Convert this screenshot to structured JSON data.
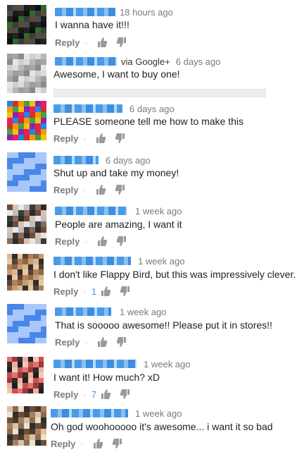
{
  "labels": {
    "reply": "Reply"
  },
  "comments": [
    {
      "via": "",
      "time": "18 hours ago",
      "text": "I wanna have it!!!",
      "likes": "",
      "avatar_colors": [
        "#3b3b3b",
        "#1a1a1a",
        "#2d6b2a",
        "#4c4c4c",
        "#0f0f0f",
        "#5a4a3a",
        "#222222"
      ]
    },
    {
      "via": "via Google+",
      "time": "6 days ago",
      "text": "Awesome, I want to buy one!",
      "likes": "",
      "avatar_colors": [
        "#cfcfcf",
        "#9e9e9e",
        "#e5e5e5",
        "#b7b7b7",
        "#8a8a8a",
        "#dcdcdc",
        "#a5a5a5"
      ]
    },
    {
      "via": "",
      "time": "6 days ago",
      "text": "PLEASE someone tell me how to make this",
      "likes": "",
      "avatar_colors": [
        "#d32f2f",
        "#f4c20d",
        "#1e88e5",
        "#43a047",
        "#e91e63",
        "#ff9800",
        "#8e24aa"
      ]
    },
    {
      "via": "",
      "time": "6 days ago",
      "text": "Shut up and take my money!",
      "likes": "",
      "avatar_colors": [
        "#a8c7fa",
        "#a8c7fa",
        "#4a86e8",
        "#a8c7fa",
        "#4a86e8",
        "#a8c7fa",
        "#4a86e8"
      ]
    },
    {
      "via": "",
      "time": "1 week ago",
      "text": "People are amazing, I want it",
      "likes": "",
      "avatar_colors": [
        "#e6e6e6",
        "#8c6a55",
        "#d9c2b0",
        "#3a3a3a",
        "#6d4c3d",
        "#bfbfbf",
        "#2b2b2b"
      ]
    },
    {
      "via": "",
      "time": "1 week ago",
      "text": "I don't like Flappy Bird, but this was impressively clever.",
      "likes": "1",
      "avatar_colors": [
        "#c99b6d",
        "#e8c8a0",
        "#8a6a48",
        "#2e2e2e",
        "#b08060",
        "#d8b890",
        "#5a4030"
      ]
    },
    {
      "via": "",
      "time": "1 week ago",
      "text": "That is sooooo awesome!! Please put it in stores!!",
      "likes": "",
      "avatar_colors": [
        "#a8c7fa",
        "#a8c7fa",
        "#4a86e8",
        "#a8c7fa",
        "#4a86e8",
        "#a8c7fa",
        "#4a86e8"
      ]
    },
    {
      "via": "",
      "time": "1 week ago",
      "text": "I want it! How much? xD",
      "likes": "7",
      "avatar_colors": [
        "#e57373",
        "#f0b0a0",
        "#c94f4f",
        "#3a2a2a",
        "#f3c6b4",
        "#9a3a3a",
        "#1e1e1e"
      ]
    },
    {
      "via": "",
      "time": "1 week ago",
      "text": "Oh god woohooooo it's awesome... i want it so bad",
      "likes": "",
      "avatar_colors": [
        "#6b4f3a",
        "#d8c2a8",
        "#2e2e2e",
        "#a88060",
        "#f0e0c8",
        "#4a3828",
        "#8c6c50"
      ]
    }
  ]
}
